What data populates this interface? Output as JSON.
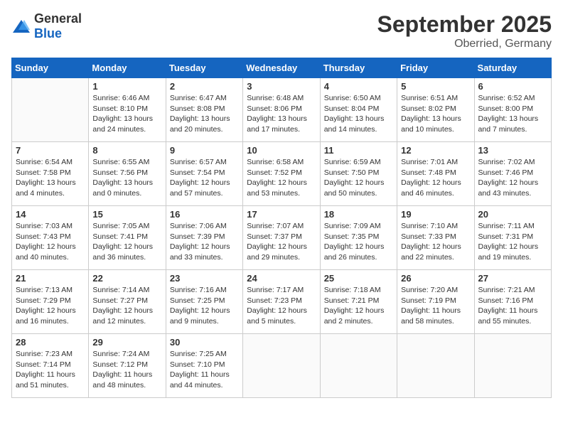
{
  "header": {
    "logo_general": "General",
    "logo_blue": "Blue",
    "month": "September 2025",
    "location": "Oberried, Germany"
  },
  "weekdays": [
    "Sunday",
    "Monday",
    "Tuesday",
    "Wednesday",
    "Thursday",
    "Friday",
    "Saturday"
  ],
  "weeks": [
    [
      {
        "day": "",
        "info": ""
      },
      {
        "day": "1",
        "info": "Sunrise: 6:46 AM\nSunset: 8:10 PM\nDaylight: 13 hours\nand 24 minutes."
      },
      {
        "day": "2",
        "info": "Sunrise: 6:47 AM\nSunset: 8:08 PM\nDaylight: 13 hours\nand 20 minutes."
      },
      {
        "day": "3",
        "info": "Sunrise: 6:48 AM\nSunset: 8:06 PM\nDaylight: 13 hours\nand 17 minutes."
      },
      {
        "day": "4",
        "info": "Sunrise: 6:50 AM\nSunset: 8:04 PM\nDaylight: 13 hours\nand 14 minutes."
      },
      {
        "day": "5",
        "info": "Sunrise: 6:51 AM\nSunset: 8:02 PM\nDaylight: 13 hours\nand 10 minutes."
      },
      {
        "day": "6",
        "info": "Sunrise: 6:52 AM\nSunset: 8:00 PM\nDaylight: 13 hours\nand 7 minutes."
      }
    ],
    [
      {
        "day": "7",
        "info": "Sunrise: 6:54 AM\nSunset: 7:58 PM\nDaylight: 13 hours\nand 4 minutes."
      },
      {
        "day": "8",
        "info": "Sunrise: 6:55 AM\nSunset: 7:56 PM\nDaylight: 13 hours\nand 0 minutes."
      },
      {
        "day": "9",
        "info": "Sunrise: 6:57 AM\nSunset: 7:54 PM\nDaylight: 12 hours\nand 57 minutes."
      },
      {
        "day": "10",
        "info": "Sunrise: 6:58 AM\nSunset: 7:52 PM\nDaylight: 12 hours\nand 53 minutes."
      },
      {
        "day": "11",
        "info": "Sunrise: 6:59 AM\nSunset: 7:50 PM\nDaylight: 12 hours\nand 50 minutes."
      },
      {
        "day": "12",
        "info": "Sunrise: 7:01 AM\nSunset: 7:48 PM\nDaylight: 12 hours\nand 46 minutes."
      },
      {
        "day": "13",
        "info": "Sunrise: 7:02 AM\nSunset: 7:46 PM\nDaylight: 12 hours\nand 43 minutes."
      }
    ],
    [
      {
        "day": "14",
        "info": "Sunrise: 7:03 AM\nSunset: 7:43 PM\nDaylight: 12 hours\nand 40 minutes."
      },
      {
        "day": "15",
        "info": "Sunrise: 7:05 AM\nSunset: 7:41 PM\nDaylight: 12 hours\nand 36 minutes."
      },
      {
        "day": "16",
        "info": "Sunrise: 7:06 AM\nSunset: 7:39 PM\nDaylight: 12 hours\nand 33 minutes."
      },
      {
        "day": "17",
        "info": "Sunrise: 7:07 AM\nSunset: 7:37 PM\nDaylight: 12 hours\nand 29 minutes."
      },
      {
        "day": "18",
        "info": "Sunrise: 7:09 AM\nSunset: 7:35 PM\nDaylight: 12 hours\nand 26 minutes."
      },
      {
        "day": "19",
        "info": "Sunrise: 7:10 AM\nSunset: 7:33 PM\nDaylight: 12 hours\nand 22 minutes."
      },
      {
        "day": "20",
        "info": "Sunrise: 7:11 AM\nSunset: 7:31 PM\nDaylight: 12 hours\nand 19 minutes."
      }
    ],
    [
      {
        "day": "21",
        "info": "Sunrise: 7:13 AM\nSunset: 7:29 PM\nDaylight: 12 hours\nand 16 minutes."
      },
      {
        "day": "22",
        "info": "Sunrise: 7:14 AM\nSunset: 7:27 PM\nDaylight: 12 hours\nand 12 minutes."
      },
      {
        "day": "23",
        "info": "Sunrise: 7:16 AM\nSunset: 7:25 PM\nDaylight: 12 hours\nand 9 minutes."
      },
      {
        "day": "24",
        "info": "Sunrise: 7:17 AM\nSunset: 7:23 PM\nDaylight: 12 hours\nand 5 minutes."
      },
      {
        "day": "25",
        "info": "Sunrise: 7:18 AM\nSunset: 7:21 PM\nDaylight: 12 hours\nand 2 minutes."
      },
      {
        "day": "26",
        "info": "Sunrise: 7:20 AM\nSunset: 7:19 PM\nDaylight: 11 hours\nand 58 minutes."
      },
      {
        "day": "27",
        "info": "Sunrise: 7:21 AM\nSunset: 7:16 PM\nDaylight: 11 hours\nand 55 minutes."
      }
    ],
    [
      {
        "day": "28",
        "info": "Sunrise: 7:23 AM\nSunset: 7:14 PM\nDaylight: 11 hours\nand 51 minutes."
      },
      {
        "day": "29",
        "info": "Sunrise: 7:24 AM\nSunset: 7:12 PM\nDaylight: 11 hours\nand 48 minutes."
      },
      {
        "day": "30",
        "info": "Sunrise: 7:25 AM\nSunset: 7:10 PM\nDaylight: 11 hours\nand 44 minutes."
      },
      {
        "day": "",
        "info": ""
      },
      {
        "day": "",
        "info": ""
      },
      {
        "day": "",
        "info": ""
      },
      {
        "day": "",
        "info": ""
      }
    ]
  ]
}
